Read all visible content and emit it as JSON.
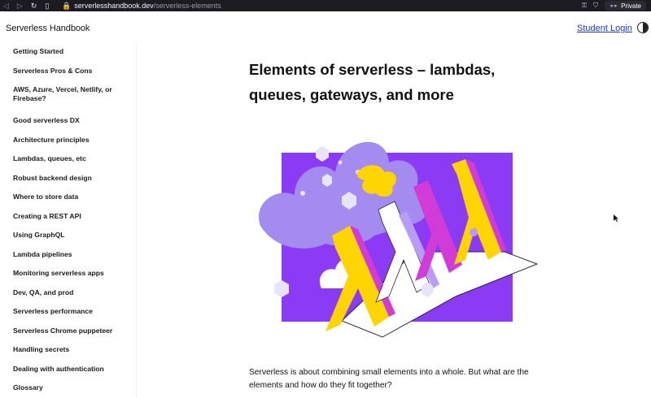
{
  "browser": {
    "url_host": "serverlesshandbook.dev",
    "url_path": "/serverless-elements",
    "private_label": "Private"
  },
  "header": {
    "site_title": "Serverless Handbook",
    "login_label": "Student Login"
  },
  "sidebar": {
    "items": [
      {
        "label": "Getting Started"
      },
      {
        "label": "Serverless Pros & Cons"
      },
      {
        "label": "AWS, Azure, Vercel, Netlify, or Firebase?"
      },
      {
        "label": "Good serverless DX"
      },
      {
        "label": "Architecture principles"
      },
      {
        "label": "Lambdas, queues, etc"
      },
      {
        "label": "Robust backend design"
      },
      {
        "label": "Where to store data"
      },
      {
        "label": "Creating a REST API"
      },
      {
        "label": "Using GraphQL"
      },
      {
        "label": "Lambda pipelines"
      },
      {
        "label": "Monitoring serverless apps"
      },
      {
        "label": "Dev, QA, and prod"
      },
      {
        "label": "Serverless performance"
      },
      {
        "label": "Serverless Chrome puppeteer"
      },
      {
        "label": "Handling secrets"
      },
      {
        "label": "Dealing with authentication"
      },
      {
        "label": "Glossary"
      }
    ]
  },
  "main": {
    "title": "Elements of serverless – lambdas, queues, gateways, and more",
    "intro": "Serverless is about combining small elements into a whole. But what are the elements and how do they fit together?"
  },
  "colors": {
    "chrome_bg": "#1c1b22",
    "link": "#1a37c9",
    "purple": "#8c3bf5",
    "lavender": "#a88ef2",
    "yellow": "#ffd500",
    "magenta": "#d13bd6"
  },
  "icons": [
    "back-icon",
    "forward-icon",
    "reload-icon",
    "bookmark-icon",
    "lock-icon",
    "key-icon",
    "shield-icon",
    "private-mask-icon",
    "theme-toggle-icon"
  ]
}
